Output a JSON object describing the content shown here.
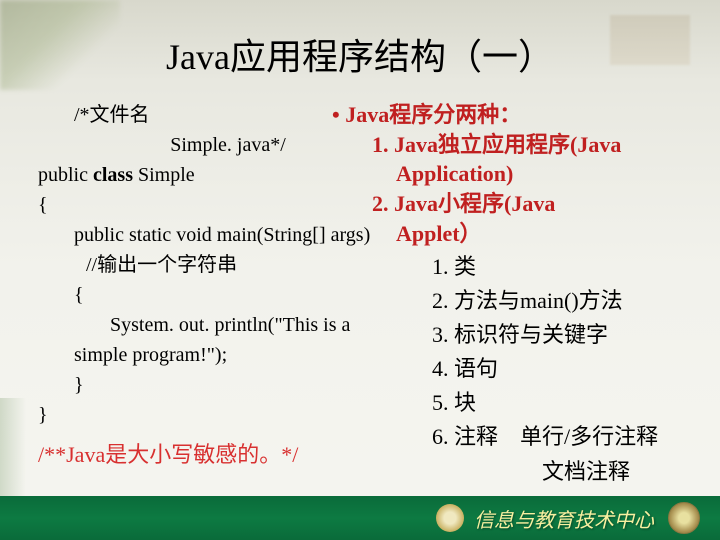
{
  "title": "Java应用程序结构（一）",
  "code": {
    "l1a": "/*文件名",
    "l1b": "Simple. java*/",
    "l2a": "public ",
    "l2b": "class ",
    "l2c": "Simple",
    "l3": "{",
    "l4": "public static void main(String[] args)",
    "l5": "//输出一个字符串",
    "l6": "{",
    "l7": "System. out. println(\"This is a",
    "l8": "simple program!\");",
    "l9": "}",
    "l10": "}",
    "note": "/**Java是大小写敏感的。*/"
  },
  "right_top": {
    "bullet": "• Java程序分两种：",
    "item1a": "1.  Java独立应用程序(Java",
    "item1b": "Application)",
    "item2a": "2.  Java小程序(Java",
    "item2b": "Applet）"
  },
  "right_list": {
    "i1": "1. 类",
    "i2": "2. 方法与main()方法",
    "i3": "3. 标识符与关键字",
    "i4": "4. 语句",
    "i5": "5. 块",
    "i6": "6. 注释　单行/多行注释",
    "i7": "文档注释"
  },
  "footer": {
    "text": "信息与教育技术中心"
  }
}
